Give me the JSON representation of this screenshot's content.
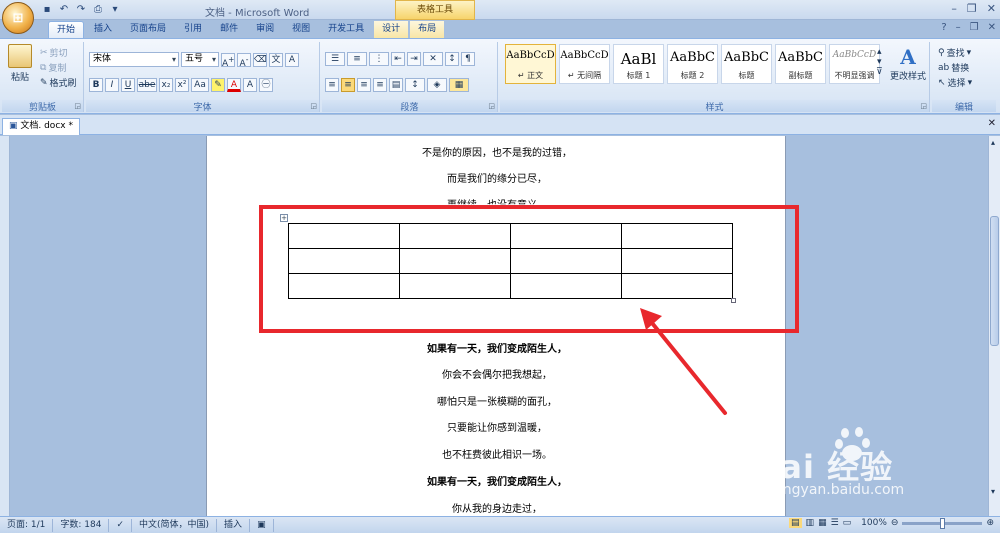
{
  "window": {
    "title": "文档 - Microsoft Word",
    "contextual_tab_group": "表格工具"
  },
  "qat": [
    "save-icon",
    "undo-icon",
    "redo-icon",
    "print-preview-icon"
  ],
  "tabs": [
    {
      "label": "开始",
      "active": true
    },
    {
      "label": "插入"
    },
    {
      "label": "页面布局"
    },
    {
      "label": "引用"
    },
    {
      "label": "邮件"
    },
    {
      "label": "审阅"
    },
    {
      "label": "视图"
    },
    {
      "label": "开发工具"
    },
    {
      "label": "设计",
      "contextual": true
    },
    {
      "label": "布局",
      "contextual": true
    }
  ],
  "clipboard": {
    "paste": "粘贴",
    "cut": "剪切",
    "copy": "复制",
    "format_painter": "格式刷",
    "label": "剪贴板"
  },
  "font": {
    "name": "宋体",
    "size": "五号",
    "label": "字体",
    "buttons": [
      "B",
      "I",
      "U",
      "abe",
      "x₂",
      "x²",
      "Aa",
      "A"
    ]
  },
  "paragraph": {
    "label": "段落"
  },
  "styles": {
    "label": "样式",
    "items": [
      {
        "sample": "AaBbCcD",
        "name": "↵ 正文",
        "selected": true
      },
      {
        "sample": "AaBbCcD",
        "name": "↵ 无间隔"
      },
      {
        "sample": "AaBl",
        "name": "标题 1",
        "big": true
      },
      {
        "sample": "AaBbC",
        "name": "标题 2",
        "mid": true
      },
      {
        "sample": "AaBbC",
        "name": "标题",
        "mid": true
      },
      {
        "sample": "AaBbC",
        "name": "副标题",
        "mid": true
      },
      {
        "sample": "AaBbCcD",
        "name": "不明显强调",
        "italic": true
      }
    ],
    "change": "更改样式"
  },
  "editing": {
    "find": "查找",
    "replace": "替换",
    "select": "选择",
    "label": "编辑"
  },
  "document_tab": "文档. docx *",
  "document": {
    "lines_top": [
      {
        "text": "不是你的原因，也不是我的过错，",
        "bold": false
      },
      {
        "text": "而是我们的缘分已尽，",
        "bold": false
      },
      {
        "text": "再继续，也没有意义。",
        "bold": false
      }
    ],
    "table": {
      "rows": 3,
      "cols": 4
    },
    "lines_bottom": [
      {
        "text": "如果有一天，我们变成陌生人，",
        "bold": true
      },
      {
        "text": "你会不会偶尔把我想起，",
        "bold": false
      },
      {
        "text": "哪怕只是一张模糊的面孔，",
        "bold": false
      },
      {
        "text": "只要能让你感到温暖，",
        "bold": false
      },
      {
        "text": "也不枉费彼此相识一场。",
        "bold": false
      },
      {
        "text": "如果有一天，我们变成陌生人，",
        "bold": true
      },
      {
        "text": "你从我的身边走过，",
        "bold": false
      }
    ]
  },
  "status": {
    "page": "页面: 1/1",
    "words": "字数: 184",
    "language": "中文(简体，中国)",
    "mode": "插入",
    "zoom": "100%"
  },
  "watermark": {
    "brand": "Bai 经验",
    "url": "jingyan.baidu.com"
  },
  "colors": {
    "annotation": "#e8282d",
    "ribbon": "#d5e3f4",
    "workspace": "#a7bfde"
  }
}
